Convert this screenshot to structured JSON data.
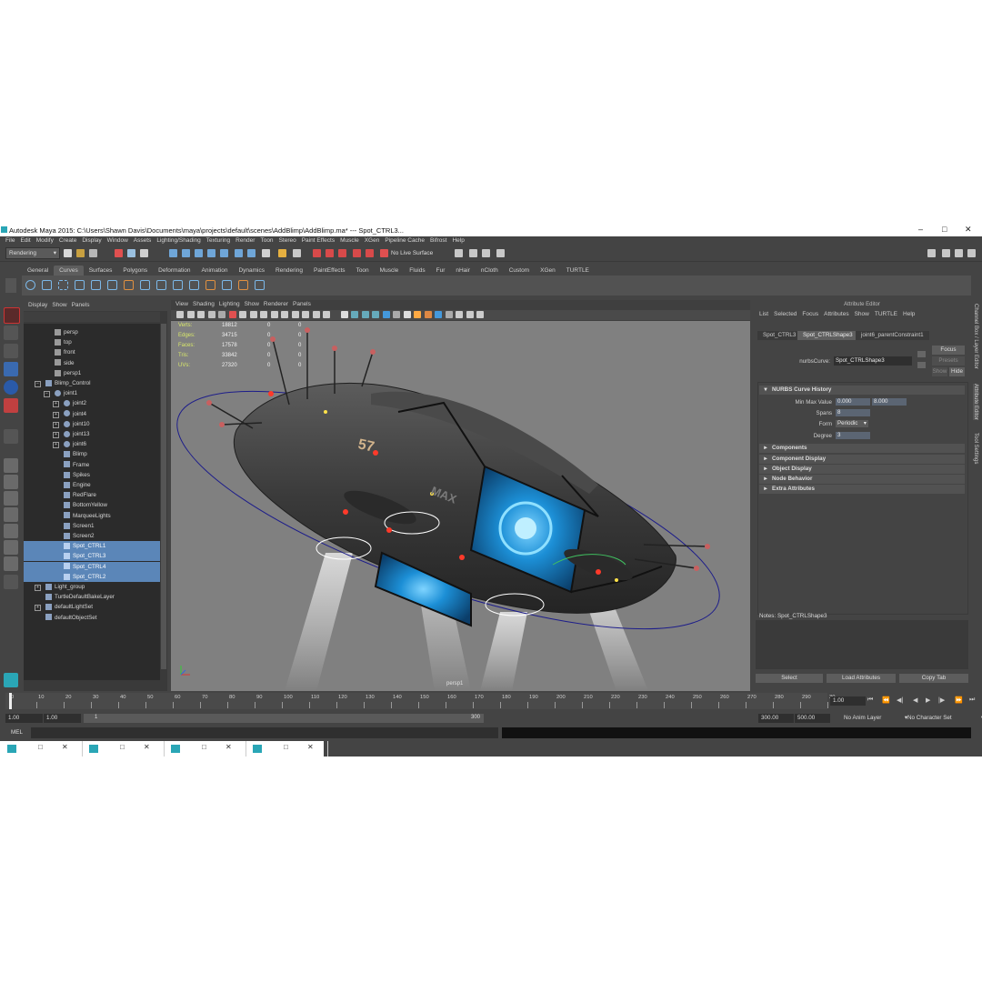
{
  "window": {
    "title": "Autodesk Maya 2015: C:\\Users\\Shawn Davis\\Documents\\maya\\projects\\default\\scenes\\AddBlimp\\AddBlimp.ma*  ---  Spot_CTRL3...",
    "minimize": "–",
    "maximize": "□",
    "close": "✕"
  },
  "menubar": [
    "File",
    "Edit",
    "Modify",
    "Create",
    "Display",
    "Window",
    "Assets",
    "Lighting/Shading",
    "Texturing",
    "Render",
    "Toon",
    "Stereo",
    "Paint Effects",
    "Muscle",
    "XGen",
    "Pipeline Cache",
    "Bifrost",
    "Help"
  ],
  "status": {
    "mode_menu": "Rendering",
    "live_surface": "No Live Surface"
  },
  "shelf": {
    "tabs": [
      "General",
      "Curves",
      "Surfaces",
      "Polygons",
      "Deformation",
      "Animation",
      "Dynamics",
      "Rendering",
      "PaintEffects",
      "Toon",
      "Muscle",
      "Fluids",
      "Fur",
      "nHair",
      "nCloth",
      "Custom",
      "XGen",
      "TURTLE"
    ],
    "active_tab": "Curves"
  },
  "outliner": {
    "menu": [
      "Display",
      "Show",
      "Panels"
    ],
    "items": [
      {
        "label": "persp",
        "selected": false
      },
      {
        "label": "top",
        "selected": false
      },
      {
        "label": "front",
        "selected": false
      },
      {
        "label": "side",
        "selected": false
      },
      {
        "label": "persp1",
        "selected": false
      },
      {
        "label": "Blimp_Control",
        "selected": false
      },
      {
        "label": "joint1",
        "selected": false
      },
      {
        "label": "joint2",
        "selected": false
      },
      {
        "label": "joint4",
        "selected": false
      },
      {
        "label": "joint10",
        "selected": false
      },
      {
        "label": "joint13",
        "selected": false
      },
      {
        "label": "joint6",
        "selected": false
      },
      {
        "label": "Blimp",
        "selected": false
      },
      {
        "label": "Frame",
        "selected": false
      },
      {
        "label": "Spikes",
        "selected": false
      },
      {
        "label": "Engine",
        "selected": false
      },
      {
        "label": "RedFlare",
        "selected": false
      },
      {
        "label": "BottomYellow",
        "selected": false
      },
      {
        "label": "MarqueeLights",
        "selected": false
      },
      {
        "label": "Screen1",
        "selected": false
      },
      {
        "label": "Screen2",
        "selected": false
      },
      {
        "label": "Spot_CTRL1",
        "selected": true
      },
      {
        "label": "Spot_CTRL3",
        "selected": true
      },
      {
        "label": "Spot_CTRL4",
        "selected": true
      },
      {
        "label": "Spot_CTRL2",
        "selected": true
      },
      {
        "label": "Light_group",
        "selected": false
      },
      {
        "label": "TurtleDefaultBakeLayer",
        "selected": false
      },
      {
        "label": "defaultLightSet",
        "selected": false
      },
      {
        "label": "defaultObjectSet",
        "selected": false
      }
    ]
  },
  "viewport": {
    "menu": [
      "View",
      "Shading",
      "Lighting",
      "Show",
      "Renderer",
      "Panels"
    ],
    "hud": [
      {
        "label": "Verts:",
        "v1": "18812",
        "v2": "0",
        "v3": "0"
      },
      {
        "label": "Edges:",
        "v1": "34715",
        "v2": "0",
        "v3": "0"
      },
      {
        "label": "Faces:",
        "v1": "17578",
        "v2": "0",
        "v3": "0"
      },
      {
        "label": "Tris:",
        "v1": "33842",
        "v2": "0",
        "v3": "0"
      },
      {
        "label": "UVs:",
        "v1": "27320",
        "v2": "0",
        "v3": "0"
      }
    ],
    "camera": "persp1",
    "hull_number": "57",
    "hull_text": "MAX"
  },
  "attribute_editor": {
    "title": "Attribute Editor",
    "menu": [
      "List",
      "Selected",
      "Focus",
      "Attributes",
      "Show",
      "TURTLE",
      "Help"
    ],
    "tabs": [
      "Spot_CTRL3",
      "Spot_CTRLShape3",
      "joint6_parentConstraint1"
    ],
    "active_tab": "Spot_CTRLShape3",
    "node_label": "nurbsCurve:",
    "node_value": "Spot_CTRLShape3",
    "focus_button": "Focus",
    "presets_button": "Presets",
    "show_button": "Show",
    "hide_button": "Hide",
    "sections": {
      "history": "NURBS Curve History",
      "components": "Components",
      "component_display": "Component Display",
      "object_display": "Object Display",
      "node_behavior": "Node Behavior",
      "extra": "Extra Attributes"
    },
    "fields": {
      "min_max_label": "Min Max Value",
      "min_value": "0.000",
      "max_value": "8.000",
      "spans_label": "Spans",
      "spans_value": "8",
      "form_label": "Form",
      "form_value": "Periodic",
      "degree_label": "Degree",
      "degree_value": "3"
    },
    "notes_label": "Notes: Spot_CTRLShape3",
    "buttons": [
      "Select",
      "Load Attributes",
      "Copy Tab"
    ]
  },
  "side_tabs": [
    "Channel Box / Layer Editor",
    "Attribute Editor",
    "Tool Settings"
  ],
  "timeline": {
    "ticks": [
      "0",
      "10",
      "20",
      "30",
      "40",
      "50",
      "60",
      "70",
      "80",
      "90",
      "100",
      "110",
      "120",
      "130",
      "140",
      "150",
      "160",
      "170",
      "180",
      "190",
      "200",
      "210",
      "220",
      "230",
      "240",
      "250",
      "260",
      "270",
      "280",
      "290",
      "30"
    ],
    "current_frame": "1.00"
  },
  "range": {
    "start": "1.00",
    "start2": "1.00",
    "slider_start": "1",
    "slider_end": "300",
    "end": "300.00",
    "end2": "500.00",
    "anim_layer": "No Anim Layer",
    "char_set": "No Character Set"
  },
  "command": {
    "label": "MEL"
  },
  "colors": {
    "selection": "#5b86b8",
    "hud_label": "#d9e86a",
    "field": "#5b6573",
    "viewport_bg": "#808080"
  }
}
